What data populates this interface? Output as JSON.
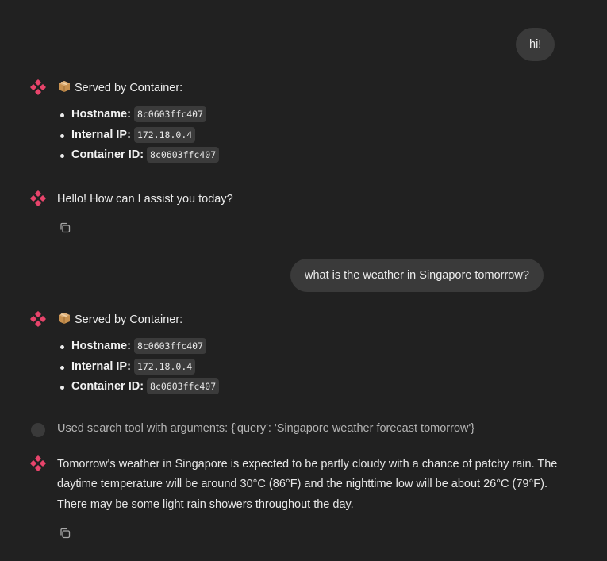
{
  "conversation": {
    "user_msg_1": "hi!",
    "served_1": {
      "heading": "Served by Container:",
      "hostname_label": "Hostname:",
      "hostname": "8c0603ffc407",
      "ip_label": "Internal IP:",
      "ip": "172.18.0.4",
      "container_label": "Container ID:",
      "container_id": "8c0603ffc407"
    },
    "bot_reply_1": "Hello! How can I assist you today?",
    "user_msg_2": "what is the weather in Singapore tomorrow?",
    "served_2": {
      "heading": "Served by Container:",
      "hostname_label": "Hostname:",
      "hostname": "8c0603ffc407",
      "ip_label": "Internal IP:",
      "ip": "172.18.0.4",
      "container_label": "Container ID:",
      "container_id": "8c0603ffc407"
    },
    "tool_call": "Used search tool with arguments: {'query': 'Singapore weather forecast tomorrow'}",
    "bot_reply_2": "Tomorrow's weather in Singapore is expected to be partly cloudy with a chance of patchy rain. The daytime temperature will be around 30°C (86°F) and the nighttime low will be about 26°C (79°F). There may be some light rain showers throughout the day."
  },
  "icons": {
    "bot": "bot-logo-icon",
    "package": "package-icon",
    "copy": "copy-icon",
    "tool": "tool-status-icon"
  },
  "colors": {
    "background": "#212121",
    "user_bubble": "#3a3a3a",
    "bot_logo": "#e8446b"
  }
}
